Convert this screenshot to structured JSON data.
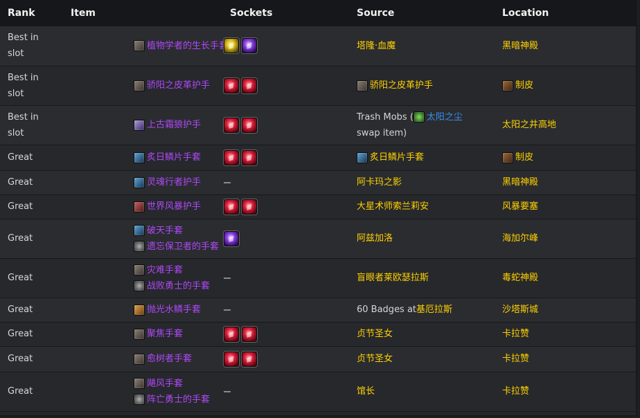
{
  "headers": {
    "rank": "Rank",
    "item": "Item",
    "sockets": "Sockets",
    "source": "Source",
    "location": "Location"
  },
  "rows": [
    {
      "rank": "Best in slot",
      "items": [
        {
          "icon": "leather-glove-icon",
          "name": "植物学者的生长手套",
          "quality": "epic"
        }
      ],
      "sockets": [
        "yellow",
        "purple"
      ],
      "source": {
        "text": "塔隆·血魔",
        "icon": null
      },
      "location": {
        "text": "黑暗神殿",
        "icon": null
      }
    },
    {
      "rank": "Best in slot",
      "items": [
        {
          "icon": "leather-glove-icon",
          "name": "骄阳之皮革护手",
          "quality": "epic"
        }
      ],
      "sockets": [
        "red",
        "red"
      ],
      "source": {
        "text": "骄阳之皮革护手",
        "icon": "leather-glove-icon"
      },
      "location": {
        "text": "制皮",
        "icon": "leather-bag-icon"
      }
    },
    {
      "rank": "Best in slot",
      "items": [
        {
          "icon": "runic-glove-icon",
          "name": "上古霜狼护手",
          "quality": "epic"
        }
      ],
      "sockets": [
        "red",
        "red"
      ],
      "source": {
        "prefix": "Trash Mobs (",
        "link": "太阳之尘",
        "link_icon": "sunwell-dust-icon",
        "suffix": "swap item)"
      },
      "location": {
        "text": "太阳之井高地",
        "icon": null
      }
    },
    {
      "rank": "Great",
      "items": [
        {
          "icon": "mail-glove-icon",
          "name": "炙日鳞片手套",
          "quality": "epic"
        }
      ],
      "sockets": [
        "red",
        "red"
      ],
      "source": {
        "text": "炙日鳞片手套",
        "icon": "mail-glove-icon"
      },
      "location": {
        "text": "制皮",
        "icon": "leather-bag-icon"
      }
    },
    {
      "rank": "Great",
      "items": [
        {
          "icon": "mail-glove-icon",
          "name": "灵魂行者护手",
          "quality": "epic"
        }
      ],
      "sockets": [],
      "source": {
        "text": "阿卡玛之影",
        "icon": null
      },
      "location": {
        "text": "黑暗神殿",
        "icon": null
      }
    },
    {
      "rank": "Great",
      "items": [
        {
          "icon": "storm-glove-icon",
          "name": "世界风暴护手",
          "quality": "epic"
        }
      ],
      "sockets": [
        "red",
        "red"
      ],
      "source": {
        "text": "大星术师索兰莉安",
        "icon": null
      },
      "location": {
        "text": "风暴要塞",
        "icon": null
      }
    },
    {
      "rank": "Great",
      "items": [
        {
          "icon": "mail-glove-icon",
          "name": "破天手套",
          "quality": "epic"
        },
        {
          "icon": "token-icon",
          "name": "遗忘保卫者的手套",
          "quality": "epic"
        }
      ],
      "sockets": [
        "purple"
      ],
      "source": {
        "text": "阿兹加洛",
        "icon": null
      },
      "location": {
        "text": "海加尔峰",
        "icon": null
      }
    },
    {
      "rank": "Great",
      "items": [
        {
          "icon": "leather-glove-icon",
          "name": "灾难手套",
          "quality": "epic"
        },
        {
          "icon": "token-icon",
          "name": "战败勇士的手套",
          "quality": "epic"
        }
      ],
      "sockets": [],
      "source": {
        "text": "盲眼者莱欧瑟拉斯",
        "icon": null
      },
      "location": {
        "text": "毒蛇神殿",
        "icon": null
      }
    },
    {
      "rank": "Great",
      "items": [
        {
          "icon": "gold-glove-icon",
          "name": "抛光水鳞手套",
          "quality": "epic"
        }
      ],
      "sockets": [],
      "source": {
        "plain": "60 Badges at ",
        "gold": "基厄拉斯"
      },
      "location": {
        "text": "沙塔斯城",
        "icon": null
      }
    },
    {
      "rank": "Great",
      "items": [
        {
          "icon": "leather-glove-icon",
          "name": "聚焦手套",
          "quality": "epic"
        }
      ],
      "sockets": [
        "red",
        "red"
      ],
      "source": {
        "text": "贞节圣女",
        "icon": null
      },
      "location": {
        "text": "卡拉赞",
        "icon": null
      }
    },
    {
      "rank": "Great",
      "items": [
        {
          "icon": "leather-glove-icon",
          "name": "愈树者手套",
          "quality": "epic"
        }
      ],
      "sockets": [
        "red",
        "red"
      ],
      "source": {
        "text": "贞节圣女",
        "icon": null
      },
      "location": {
        "text": "卡拉赞",
        "icon": null
      }
    },
    {
      "rank": "Great",
      "items": [
        {
          "icon": "leather-glove-icon",
          "name": "飓风手套",
          "quality": "epic"
        },
        {
          "icon": "token-icon",
          "name": "阵亡勇士的手套",
          "quality": "epic"
        }
      ],
      "sockets": [],
      "source": {
        "text": "馆长",
        "icon": null
      },
      "location": {
        "text": "卡拉赞",
        "icon": null
      }
    }
  ]
}
